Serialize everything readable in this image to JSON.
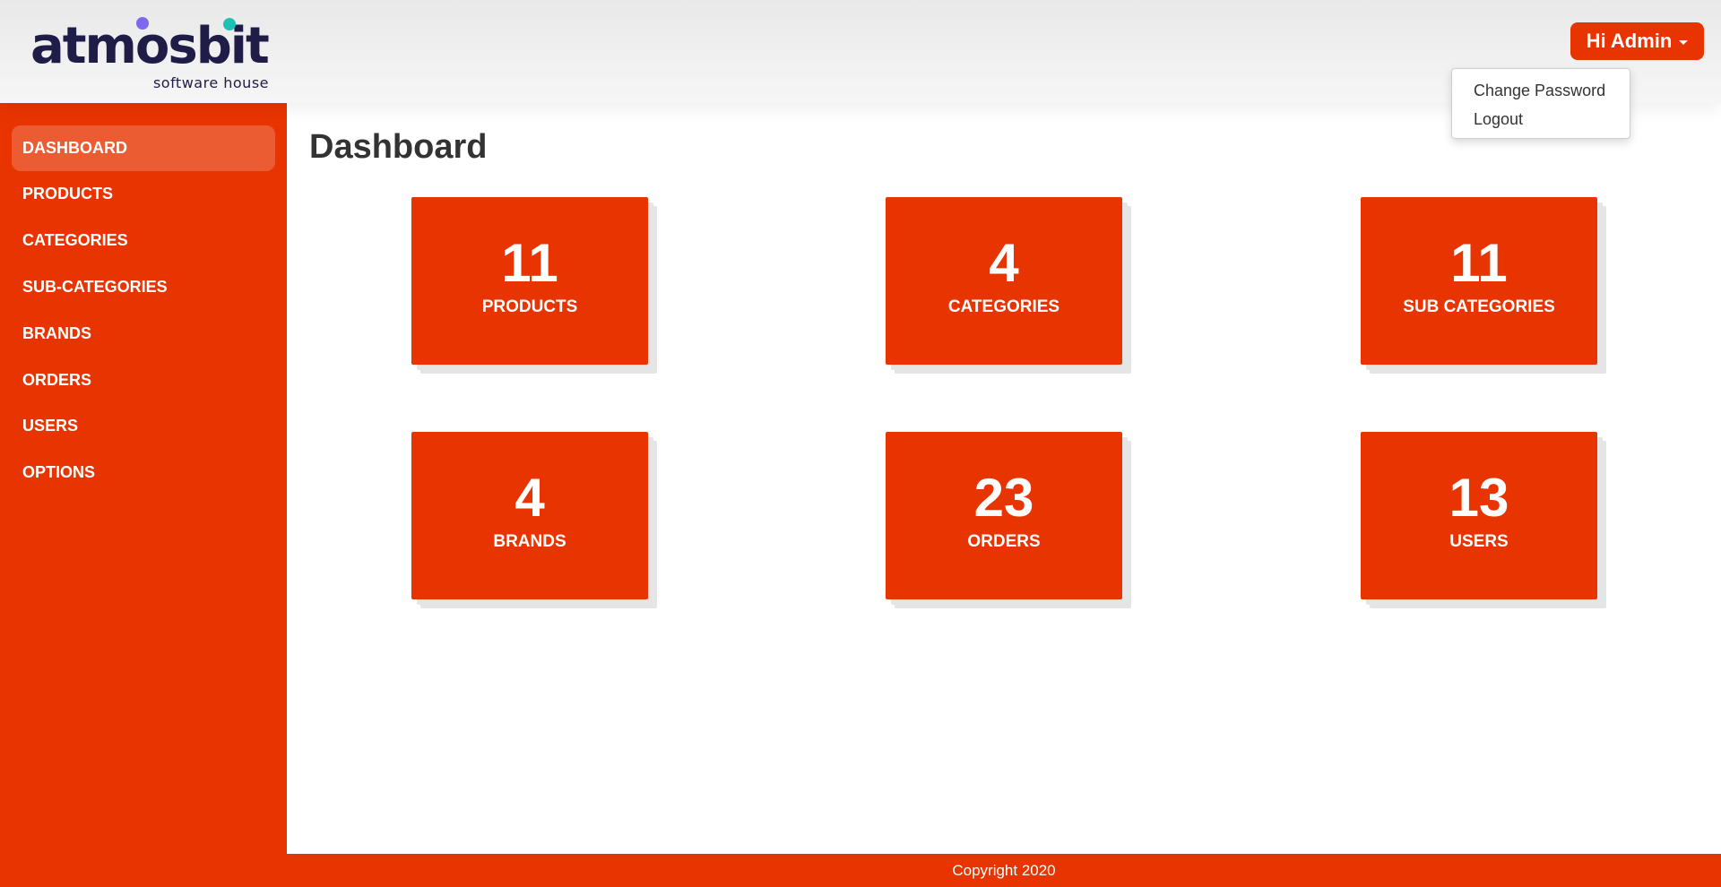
{
  "header": {
    "logo_text": "atmosbit",
    "logo_tagline": "software house",
    "user_menu_label": "Hi Admin",
    "dropdown": {
      "items": [
        {
          "label": "Change Password"
        },
        {
          "label": "Logout"
        }
      ]
    }
  },
  "sidebar": {
    "items": [
      {
        "label": "DASHBOARD",
        "active": true
      },
      {
        "label": "PRODUCTS"
      },
      {
        "label": "CATEGORIES"
      },
      {
        "label": "SUB-CATEGORIES"
      },
      {
        "label": "BRANDS"
      },
      {
        "label": "ORDERS"
      },
      {
        "label": "USERS"
      },
      {
        "label": "OPTIONS"
      }
    ]
  },
  "main": {
    "title": "Dashboard",
    "cards": [
      {
        "value": "11",
        "label": "PRODUCTS"
      },
      {
        "value": "4",
        "label": "CATEGORIES"
      },
      {
        "value": "11",
        "label": "SUB CATEGORIES"
      },
      {
        "value": "4",
        "label": "BRANDS"
      },
      {
        "value": "23",
        "label": "ORDERS"
      },
      {
        "value": "13",
        "label": "USERS"
      }
    ]
  },
  "footer": {
    "copyright": "Copyright 2020"
  },
  "colors": {
    "accent": "#e83400",
    "logo_dark": "#1f1c47",
    "logo_purple": "#7b68ee",
    "logo_teal": "#20c1b5"
  }
}
